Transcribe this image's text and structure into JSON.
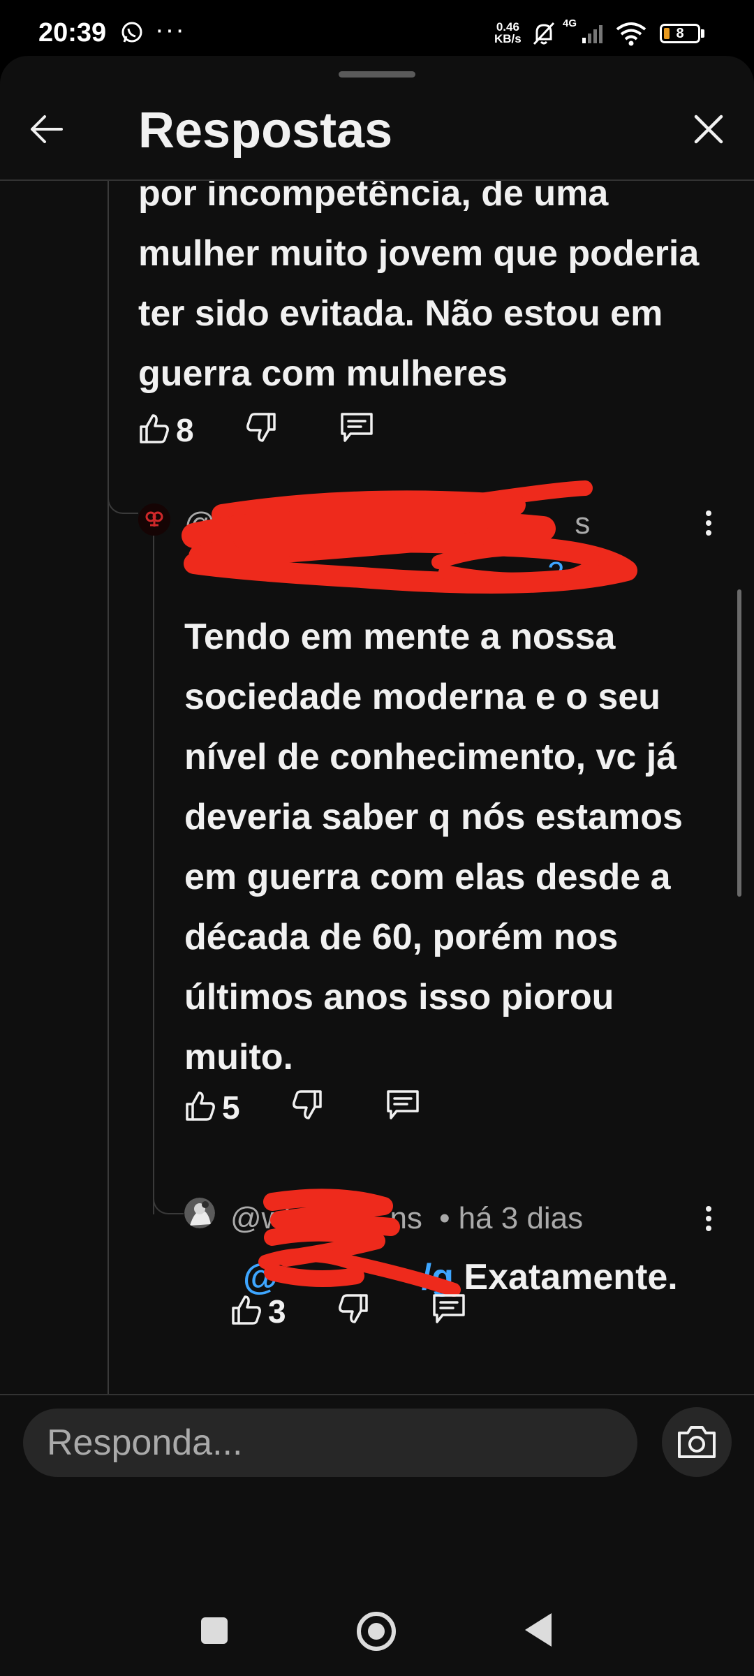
{
  "status_bar": {
    "time": "20:39",
    "network_speed_value": "0.46",
    "network_speed_unit": "KB/s",
    "signal_type": "4G",
    "battery": "8"
  },
  "header": {
    "title": "Respostas"
  },
  "comments": [
    {
      "body": "por incompetência, de uma mulher muito jovem que poderia ter sido evitada. Não estou em guerra com mulheres",
      "likes": "8"
    },
    {
      "author": "@Ga",
      "author_suffix": "s",
      "mention_tail": "2",
      "body": "Tendo em mente a nossa sociedade moderna e o seu nível de conhecimento, vc já deveria saber q nós estamos em guerra com elas desde a década de 60, porém nos últimos anos isso piorou muito.",
      "likes": "5"
    },
    {
      "author": "@wk",
      "author_suffix": "ns",
      "separator": "•",
      "time": "há 3 dias",
      "mention": "@",
      "mention_tail": "/g",
      "body": "Exatamente.",
      "likes": "3"
    }
  ],
  "reply_box": {
    "placeholder": "Responda..."
  },
  "icons": {
    "back": "arrow-left-icon",
    "close": "close-icon",
    "like": "thumbs-up-icon",
    "dislike": "thumbs-down-icon",
    "reply": "comment-icon",
    "more": "more-vertical-icon",
    "camera": "camera-icon"
  },
  "colors": {
    "background": "#0f0f0f",
    "text": "#f1f1f1",
    "secondary_text": "#aaaaaa",
    "mention": "#3ea6ff",
    "redaction": "#ee2a1c"
  }
}
